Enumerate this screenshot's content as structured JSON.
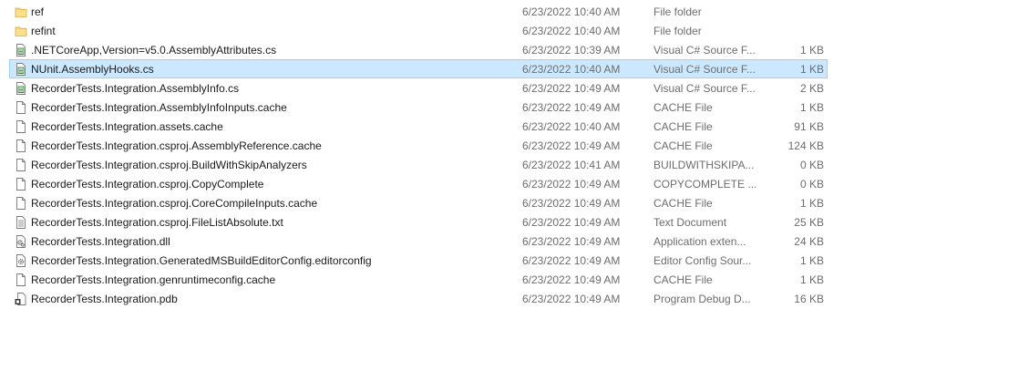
{
  "files": [
    {
      "name": "ref",
      "date": "6/23/2022 10:40 AM",
      "type": "File folder",
      "size": "",
      "icon": "folder-icon"
    },
    {
      "name": "refint",
      "date": "6/23/2022 10:40 AM",
      "type": "File folder",
      "size": "",
      "icon": "folder-icon"
    },
    {
      "name": ".NETCoreApp,Version=v5.0.AssemblyAttributes.cs",
      "date": "6/23/2022 10:39 AM",
      "type": "Visual C# Source F...",
      "size": "1 KB",
      "icon": "csharp-file-icon"
    },
    {
      "name": "NUnit.AssemblyHooks.cs",
      "date": "6/23/2022 10:40 AM",
      "type": "Visual C# Source F...",
      "size": "1 KB",
      "icon": "csharp-file-icon",
      "selected": true
    },
    {
      "name": "RecorderTests.Integration.AssemblyInfo.cs",
      "date": "6/23/2022 10:49 AM",
      "type": "Visual C# Source F...",
      "size": "2 KB",
      "icon": "csharp-file-icon"
    },
    {
      "name": "RecorderTests.Integration.AssemblyInfoInputs.cache",
      "date": "6/23/2022 10:49 AM",
      "type": "CACHE File",
      "size": "1 KB",
      "icon": "blank-file-icon"
    },
    {
      "name": "RecorderTests.Integration.assets.cache",
      "date": "6/23/2022 10:40 AM",
      "type": "CACHE File",
      "size": "91 KB",
      "icon": "blank-file-icon"
    },
    {
      "name": "RecorderTests.Integration.csproj.AssemblyReference.cache",
      "date": "6/23/2022 10:49 AM",
      "type": "CACHE File",
      "size": "124 KB",
      "icon": "blank-file-icon"
    },
    {
      "name": "RecorderTests.Integration.csproj.BuildWithSkipAnalyzers",
      "date": "6/23/2022 10:41 AM",
      "type": "BUILDWITHSKIPA...",
      "size": "0 KB",
      "icon": "blank-file-icon"
    },
    {
      "name": "RecorderTests.Integration.csproj.CopyComplete",
      "date": "6/23/2022 10:49 AM",
      "type": "COPYCOMPLETE ...",
      "size": "0 KB",
      "icon": "blank-file-icon"
    },
    {
      "name": "RecorderTests.Integration.csproj.CoreCompileInputs.cache",
      "date": "6/23/2022 10:49 AM",
      "type": "CACHE File",
      "size": "1 KB",
      "icon": "blank-file-icon"
    },
    {
      "name": "RecorderTests.Integration.csproj.FileListAbsolute.txt",
      "date": "6/23/2022 10:49 AM",
      "type": "Text Document",
      "size": "25 KB",
      "icon": "text-file-icon"
    },
    {
      "name": "RecorderTests.Integration.dll",
      "date": "6/23/2022 10:49 AM",
      "type": "Application exten...",
      "size": "24 KB",
      "icon": "dll-file-icon"
    },
    {
      "name": "RecorderTests.Integration.GeneratedMSBuildEditorConfig.editorconfig",
      "date": "6/23/2022 10:49 AM",
      "type": "Editor Config Sour...",
      "size": "1 KB",
      "icon": "config-file-icon"
    },
    {
      "name": "RecorderTests.Integration.genruntimeconfig.cache",
      "date": "6/23/2022 10:49 AM",
      "type": "CACHE File",
      "size": "1 KB",
      "icon": "blank-file-icon"
    },
    {
      "name": "RecorderTests.Integration.pdb",
      "date": "6/23/2022 10:49 AM",
      "type": "Program Debug D...",
      "size": "16 KB",
      "icon": "pdb-file-icon"
    }
  ],
  "colors": {
    "selection_bg": "#cce8ff",
    "selection_border": "#99d1ff",
    "folder": "#ffd866",
    "csharp_green": "#2e7d32"
  }
}
